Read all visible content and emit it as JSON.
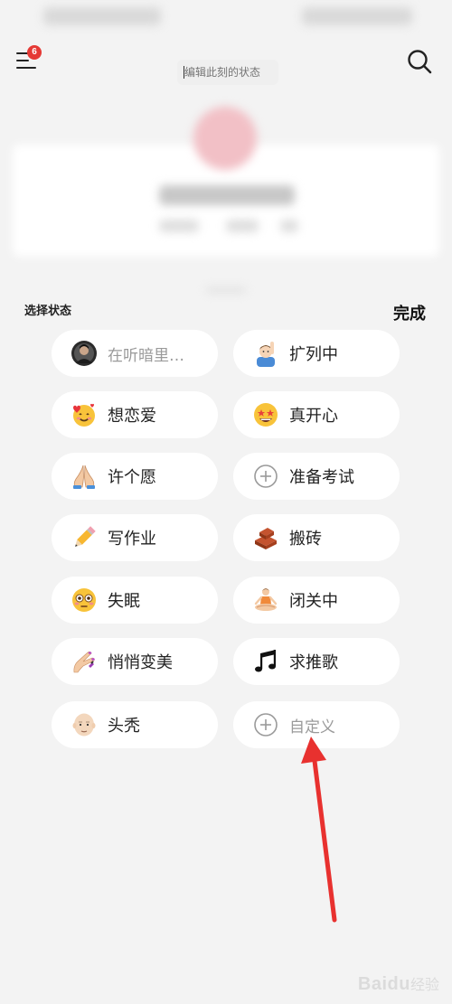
{
  "header": {
    "notification_count": "6",
    "status_placeholder": "编辑此刻的状态"
  },
  "section": {
    "title": "选择状态",
    "done_label": "完成"
  },
  "status_options": [
    {
      "label": "在听暗里…",
      "icon": "music-avatar-icon"
    },
    {
      "label": "扩列中",
      "icon": "raising-hand-person-icon"
    },
    {
      "label": "想恋爱",
      "icon": "smiling-face-with-hearts-icon"
    },
    {
      "label": "真开心",
      "icon": "star-struck-face-icon"
    },
    {
      "label": "许个愿",
      "icon": "folded-hands-icon"
    },
    {
      "label": "准备考试",
      "icon": "plus-circle-icon"
    },
    {
      "label": "写作业",
      "icon": "pencil-icon"
    },
    {
      "label": "搬砖",
      "icon": "brick-icon"
    },
    {
      "label": "失眠",
      "icon": "flushed-face-icon"
    },
    {
      "label": "闭关中",
      "icon": "meditating-person-icon"
    },
    {
      "label": "悄悄变美",
      "icon": "nail-polish-icon"
    },
    {
      "label": "求推歌",
      "icon": "music-notes-icon"
    },
    {
      "label": "头秃",
      "icon": "bald-person-icon"
    },
    {
      "label": "自定义",
      "icon": "plus-circle-icon"
    }
  ],
  "watermark": {
    "brand": "Bai",
    "suffix": "经验",
    "paw": "du"
  },
  "colors": {
    "badge": "#e53935",
    "arrow": "#e8312f",
    "pill_bg": "#ffffff",
    "page_bg": "#f3f3f3"
  }
}
